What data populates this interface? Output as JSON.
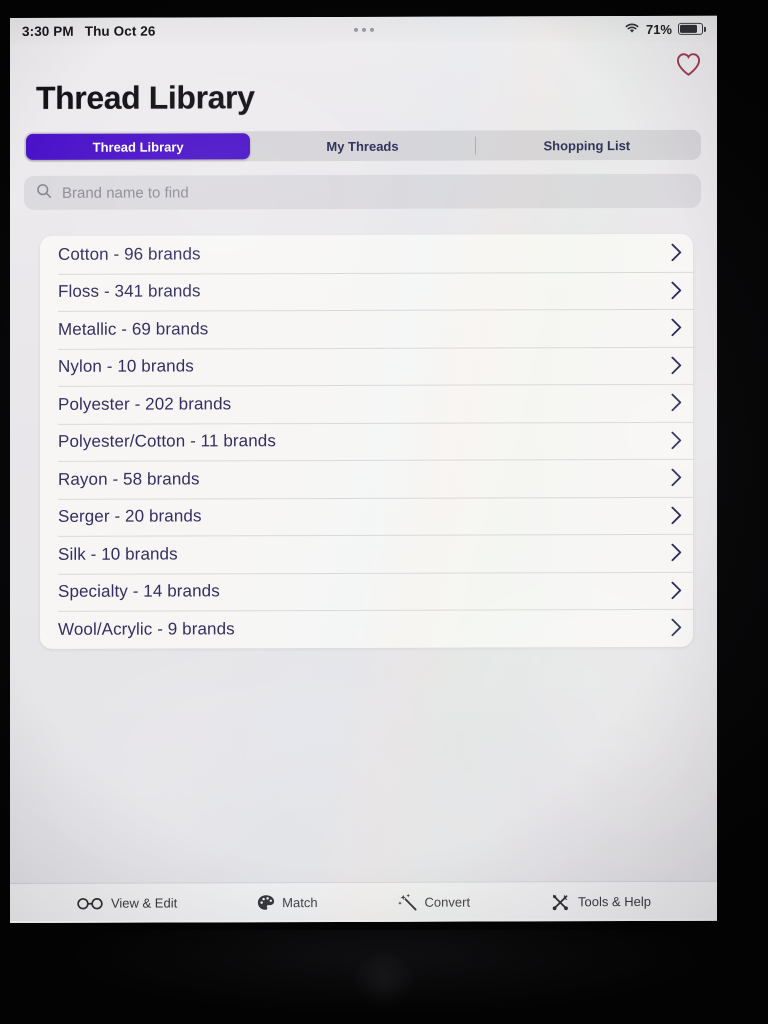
{
  "status_bar": {
    "time": "3:30 PM",
    "date": "Thu Oct 26",
    "battery_percent": "71%",
    "wifi_icon": "wifi-icon",
    "battery_icon": "battery-icon",
    "dots_icon": "more-dots-icon"
  },
  "header": {
    "title": "Thread Library",
    "favorite_icon": "heart-icon",
    "favorite_color": "#9c3a4e"
  },
  "tabs": {
    "accent_color": "#4b13c9",
    "items": [
      {
        "label": "Thread Library",
        "active": true
      },
      {
        "label": "My Threads",
        "active": false
      },
      {
        "label": "Shopping List",
        "active": false
      }
    ]
  },
  "search": {
    "placeholder": "Brand name to find",
    "value": "",
    "icon": "search-icon"
  },
  "list": {
    "chevron_icon": "chevron-right-icon",
    "items": [
      {
        "label": "Cotton - 96 brands",
        "material": "Cotton",
        "brands": 96
      },
      {
        "label": "Floss - 341 brands",
        "material": "Floss",
        "brands": 341
      },
      {
        "label": "Metallic - 69 brands",
        "material": "Metallic",
        "brands": 69
      },
      {
        "label": "Nylon - 10 brands",
        "material": "Nylon",
        "brands": 10
      },
      {
        "label": "Polyester - 202 brands",
        "material": "Polyester",
        "brands": 202
      },
      {
        "label": "Polyester/Cotton - 11 brands",
        "material": "Polyester/Cotton",
        "brands": 11
      },
      {
        "label": "Rayon - 58 brands",
        "material": "Rayon",
        "brands": 58
      },
      {
        "label": "Serger - 20 brands",
        "material": "Serger",
        "brands": 20
      },
      {
        "label": "Silk - 10 brands",
        "material": "Silk",
        "brands": 10
      },
      {
        "label": "Specialty - 14 brands",
        "material": "Specialty",
        "brands": 14
      },
      {
        "label": "Wool/Acrylic - 9 brands",
        "material": "Wool/Acrylic",
        "brands": 9
      }
    ]
  },
  "toolbar": {
    "items": [
      {
        "label": "View & Edit",
        "icon": "glasses-icon"
      },
      {
        "label": "Match",
        "icon": "palette-icon"
      },
      {
        "label": "Convert",
        "icon": "magic-wand-icon"
      },
      {
        "label": "Tools & Help",
        "icon": "tools-icon"
      }
    ]
  }
}
